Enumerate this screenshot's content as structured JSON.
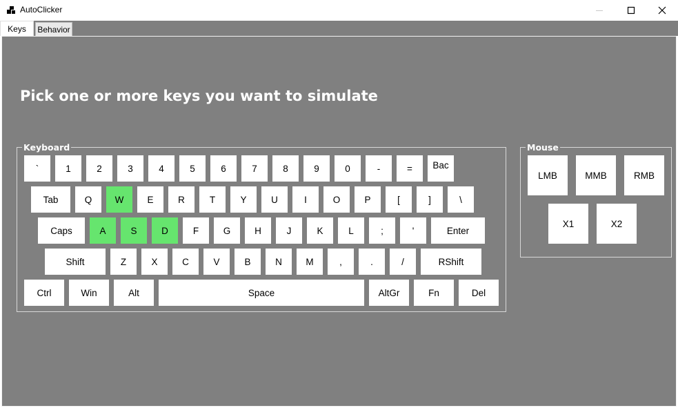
{
  "window": {
    "title": "AutoClicker",
    "icon": "app-icon",
    "controls": [
      "minimize-icon",
      "maximize-icon",
      "close-icon"
    ]
  },
  "tabs": [
    {
      "label": "Keys",
      "active": true
    },
    {
      "label": "Behavior",
      "active": false
    }
  ],
  "heading": "Pick one or more keys you want to simulate",
  "keyboard": {
    "label": "Keyboard",
    "selected_color": "#66e56e",
    "rows": [
      [
        "`",
        "1",
        "2",
        "3",
        "4",
        "5",
        "6",
        "7",
        "8",
        "9",
        "0",
        "-",
        "=",
        "Bac"
      ],
      [
        "Tab",
        "Q",
        "W",
        "E",
        "R",
        "T",
        "Y",
        "U",
        "I",
        "O",
        "P",
        "[",
        "]",
        "\\"
      ],
      [
        "Caps",
        "A",
        "S",
        "D",
        "F",
        "G",
        "H",
        "J",
        "K",
        "L",
        ";",
        "'",
        "Enter"
      ],
      [
        "Shift",
        "Z",
        "X",
        "C",
        "V",
        "B",
        "N",
        "M",
        ",",
        ".",
        "/",
        "RShift"
      ],
      [
        "Ctrl",
        "Win",
        "Alt",
        "Space",
        "AltGr",
        "Fn",
        "Del"
      ]
    ],
    "selected": [
      "W",
      "A",
      "S",
      "D"
    ]
  },
  "mouse": {
    "label": "Mouse",
    "buttons": [
      "LMB",
      "MMB",
      "RMB",
      "X1",
      "X2"
    ]
  }
}
